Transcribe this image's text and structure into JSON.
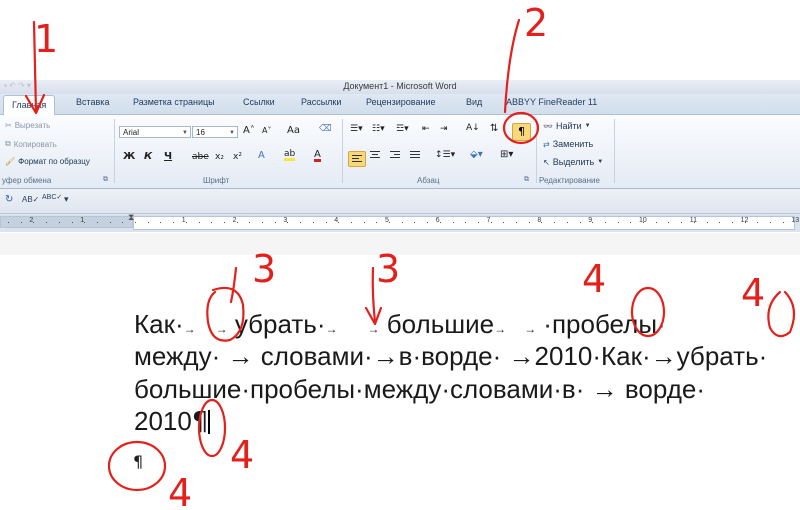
{
  "window": {
    "title": "Документ1 - Microsoft Word"
  },
  "tabs": [
    {
      "label": "Главная",
      "active": true
    },
    {
      "label": "Вставка"
    },
    {
      "label": "Разметка страницы"
    },
    {
      "label": "Ссылки"
    },
    {
      "label": "Рассылки"
    },
    {
      "label": "Рецензирование"
    },
    {
      "label": "Вид"
    },
    {
      "label": "ABBYY FineReader 11"
    }
  ],
  "clipboard": {
    "cut": "Вырезать",
    "copy": "Копировать",
    "format_painter": "Формат по образцу",
    "group_label": "уфер обмена"
  },
  "font": {
    "name": "Arial",
    "size": "16",
    "bold": "Ж",
    "italic": "К",
    "underline": "Ч",
    "strike": "abe",
    "subscript": "x₂",
    "superscript": "x²",
    "grow": "A˄",
    "shrink": "A˅",
    "change_case": "Aa",
    "group_label": "Шрифт"
  },
  "paragraph": {
    "show_marks": "¶",
    "group_label": "Абзац"
  },
  "editing": {
    "find": "Найти",
    "replace": "Заменить",
    "select": "Выделить",
    "group_label": "Редактирование"
  },
  "ruler": {
    "numbers": [
      "2",
      "1",
      "1",
      "2",
      "3",
      "4",
      "5",
      "6",
      "7",
      "8",
      "9",
      "10",
      "11",
      "12",
      "13"
    ]
  },
  "document": {
    "line1_parts": [
      "Как·",
      "→",
      " ·",
      "→",
      " убрать·",
      "→",
      "  ",
      "→",
      " большие",
      "→",
      "  ",
      "→",
      " ·пробелы·"
    ],
    "line2": "между· → словами·→в·ворде· →2010·Как·→убрать·",
    "line3": "большие·пробелы·между·словами·в· → ворде·",
    "line4_text": "2010",
    "line4_mark": "¶",
    "empty_mark": "¶"
  },
  "annotations": {
    "labels": [
      "1",
      "2",
      "3",
      "3",
      "4",
      "4",
      "4"
    ]
  }
}
